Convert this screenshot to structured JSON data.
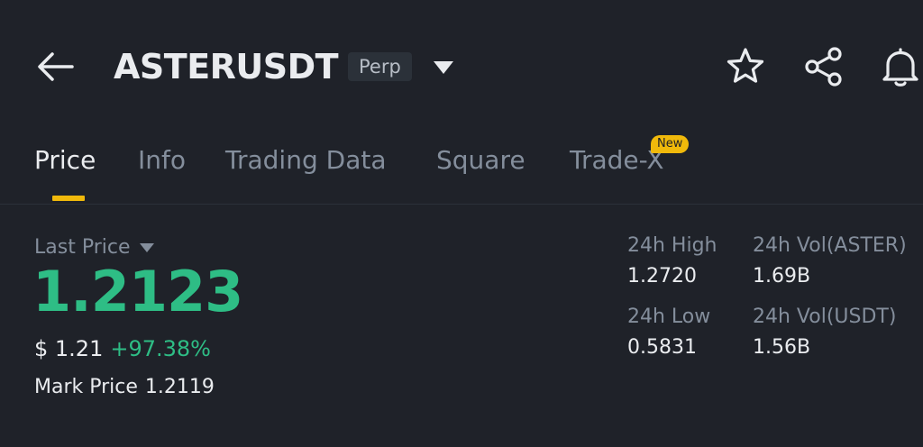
{
  "header": {
    "back_icon": "arrow-left-icon",
    "symbol": "ASTERUSDT",
    "contract_type": "Perp",
    "dropdown_icon": "caret-down-icon",
    "actions": [
      "star-icon",
      "share-icon",
      "bell-icon"
    ]
  },
  "tabs": {
    "items": [
      {
        "label": "Price",
        "active": true
      },
      {
        "label": "Info",
        "active": false
      },
      {
        "label": "Trading Data",
        "active": false
      },
      {
        "label": "Square",
        "active": false
      },
      {
        "label": "Trade-X",
        "active": false,
        "badge": "New"
      }
    ]
  },
  "price": {
    "label": "Last Price",
    "last_price": "1.2123",
    "usd_value": "$ 1.21",
    "change_pct": "+97.38%",
    "mark_label": "Mark Price",
    "mark_price": "1.2119"
  },
  "stats": {
    "high_label": "24h High",
    "high_value": "1.2720",
    "low_label": "24h Low",
    "low_value": "0.5831",
    "vol_base_label": "24h Vol(ASTER)",
    "vol_base_value": "1.69B",
    "vol_quote_label": "24h Vol(USDT)",
    "vol_quote_value": "1.56B"
  },
  "colors": {
    "background": "#1f2229",
    "text_primary": "#eaecef",
    "text_secondary": "#848e9c",
    "positive": "#2ebd85",
    "accent": "#f0b90b"
  }
}
